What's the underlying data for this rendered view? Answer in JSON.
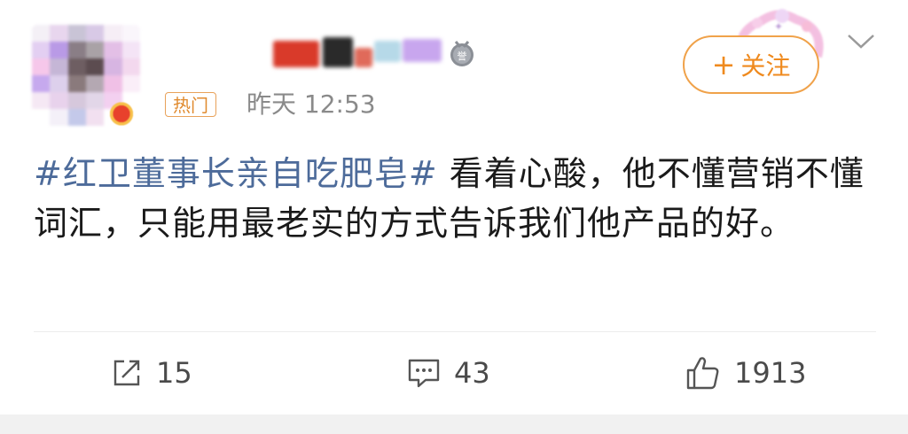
{
  "post": {
    "hot_tag": "热门",
    "timestamp": "昨天 12:53",
    "follow_label": "关注",
    "hashtag": "#红卫董事长亲自吃肥皂#",
    "body": " 看着心酸，他不懂营销不懂词汇，只能用最老实的方式告诉我们他产品的好。"
  },
  "actions": {
    "repost_count": "15",
    "comment_count": "43",
    "like_count": "1913"
  },
  "colors": {
    "hashtag": "#4d6b9a",
    "follow_accent": "#ef8a1e",
    "hot_tag": "#e08a2e",
    "timestamp": "#8a8a8a"
  },
  "icons": {
    "repost": "share-box-icon",
    "comment": "comment-bubble-icon",
    "like": "thumbs-up-icon",
    "more": "chevron-down-icon",
    "medal": "medal-icon"
  }
}
